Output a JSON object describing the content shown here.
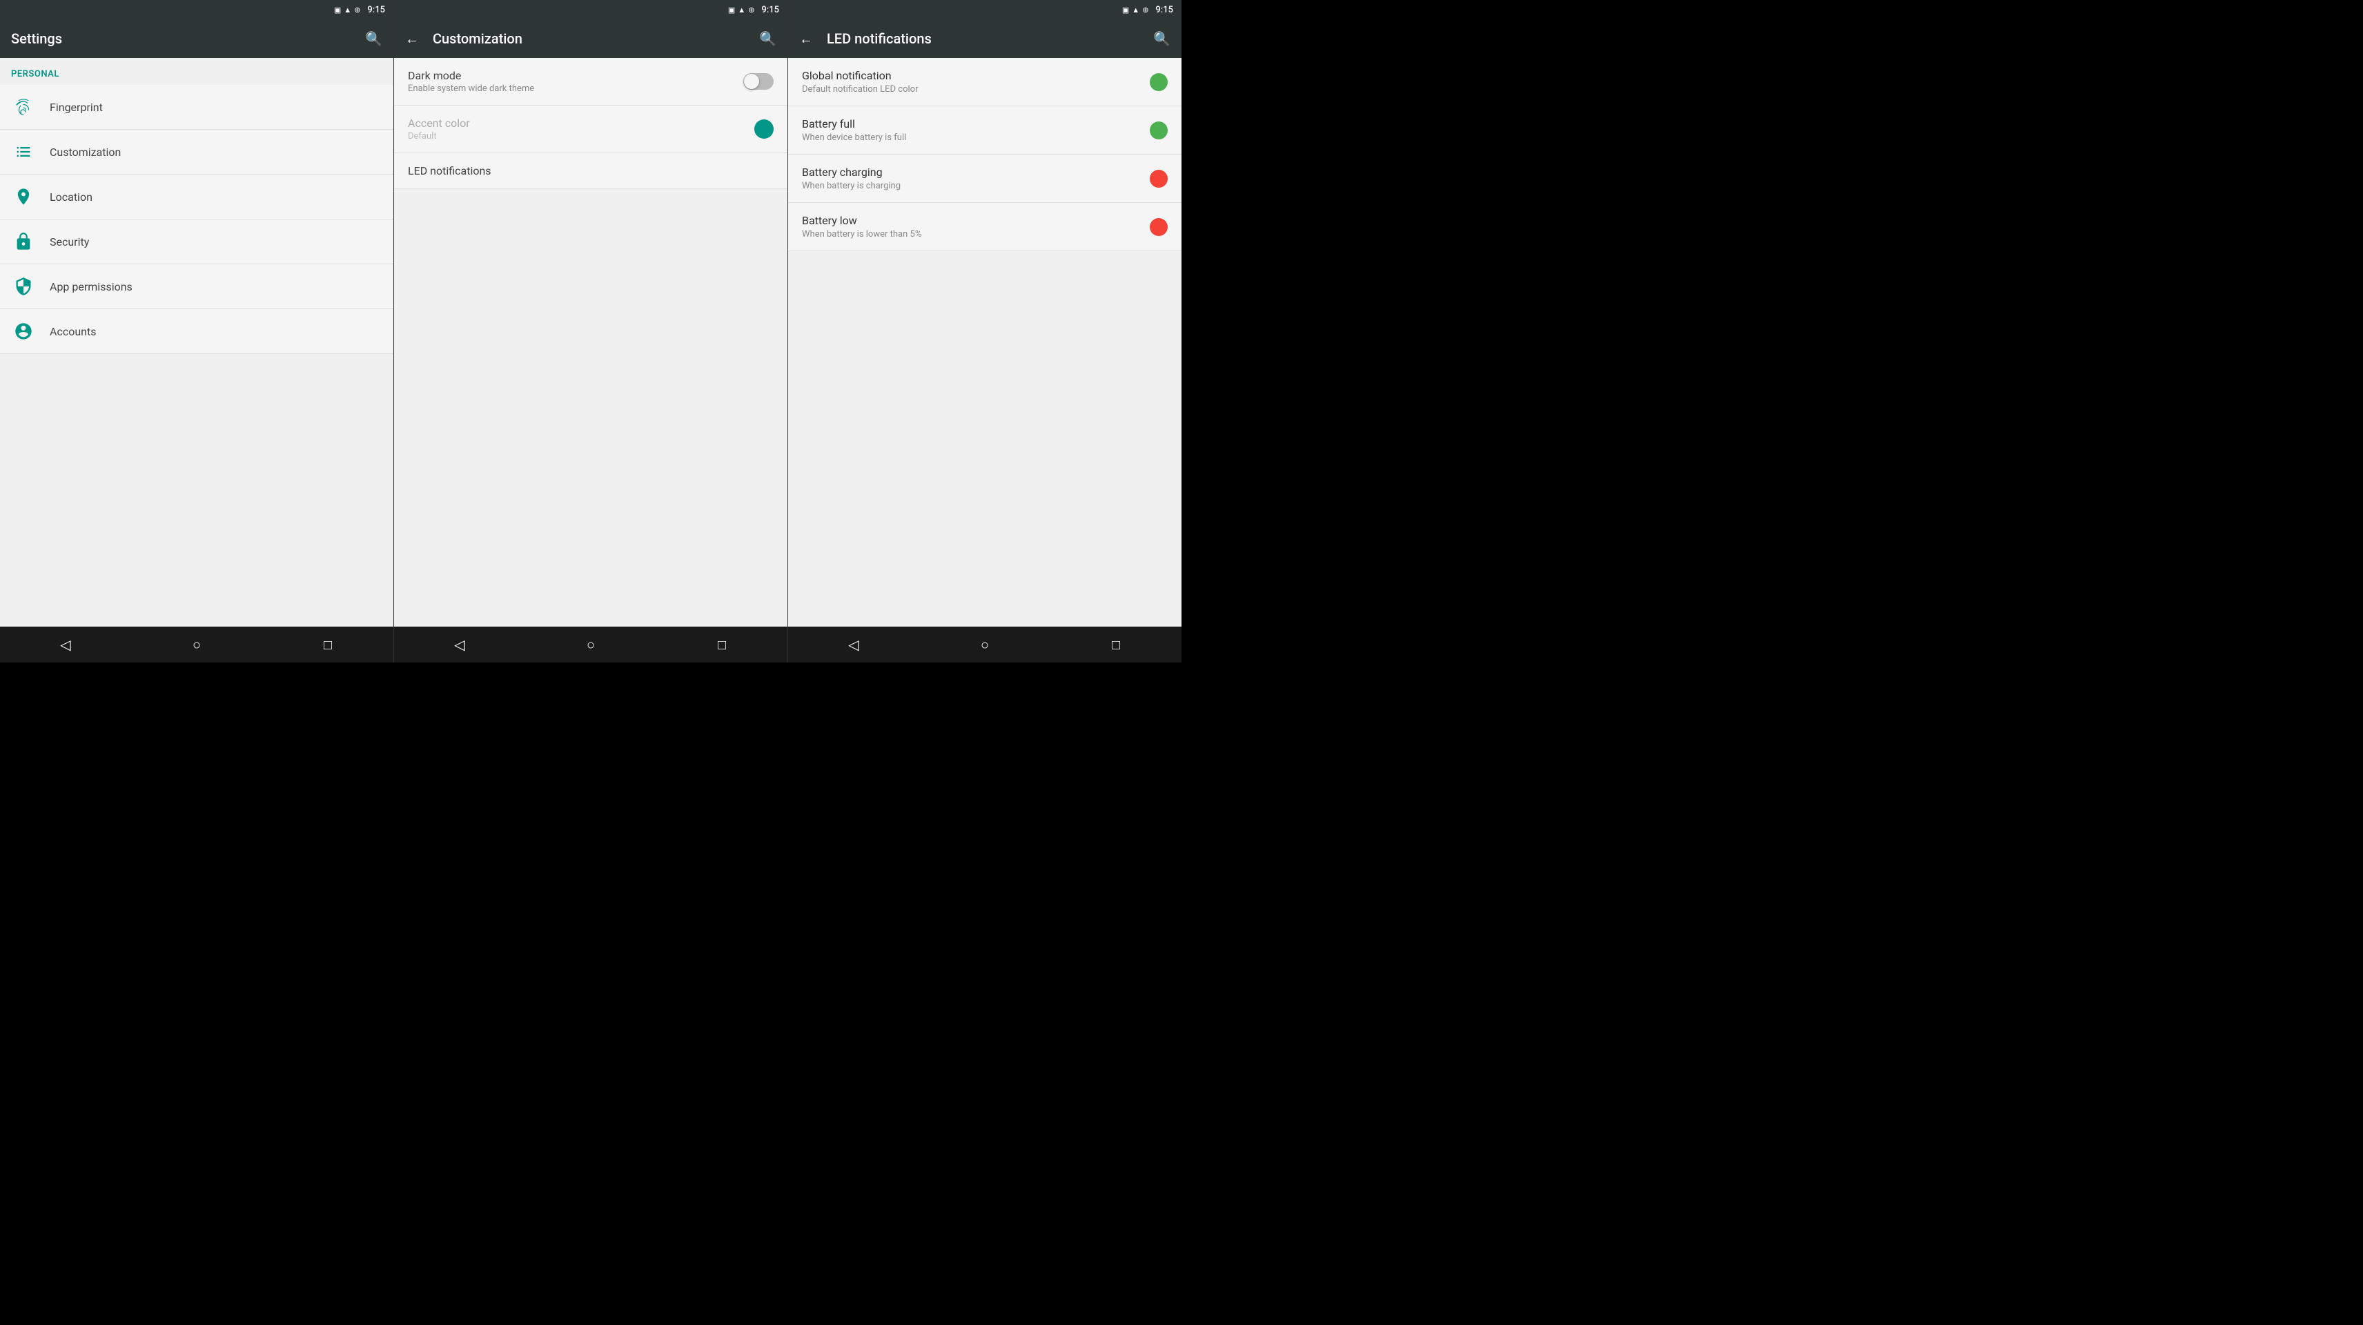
{
  "colors": {
    "teal": "#009688",
    "darkBar": "#2d3535",
    "green": "#4caf50",
    "red": "#f44336",
    "lightBg": "#f5f5f5"
  },
  "statusBar": {
    "time": "9:15"
  },
  "panel1": {
    "title": "Settings",
    "sectionLabel": "Personal",
    "items": [
      {
        "id": "fingerprint",
        "label": "Fingerprint"
      },
      {
        "id": "customization",
        "label": "Customization"
      },
      {
        "id": "location",
        "label": "Location"
      },
      {
        "id": "security",
        "label": "Security"
      },
      {
        "id": "app-permissions",
        "label": "App permissions"
      },
      {
        "id": "accounts",
        "label": "Accounts"
      }
    ],
    "nav": {
      "back": "◁",
      "home": "○",
      "recent": "□"
    }
  },
  "panel2": {
    "title": "Customization",
    "backBtn": "←",
    "rows": [
      {
        "id": "dark-mode",
        "title": "Dark mode",
        "subtitle": "Enable system wide dark theme",
        "hasToggle": true,
        "toggleOn": false,
        "hasDot": false,
        "dotColor": null,
        "dimmed": false
      },
      {
        "id": "accent-color",
        "title": "Accent color",
        "subtitle": "Default",
        "hasToggle": false,
        "hasDot": true,
        "dotColor": "#009688",
        "dimmed": true
      },
      {
        "id": "led-notifications",
        "title": "LED notifications",
        "subtitle": "",
        "hasToggle": false,
        "hasDot": false,
        "dotColor": null,
        "dimmed": false
      }
    ],
    "nav": {
      "back": "◁",
      "home": "○",
      "recent": "□"
    }
  },
  "panel3": {
    "title": "LED notifications",
    "backBtn": "←",
    "items": [
      {
        "id": "global-notification",
        "title": "Global notification",
        "subtitle": "Default notification LED color",
        "dotColor": "#4caf50"
      },
      {
        "id": "battery-full",
        "title": "Battery full",
        "subtitle": "When device battery is full",
        "dotColor": "#4caf50"
      },
      {
        "id": "battery-charging",
        "title": "Battery charging",
        "subtitle": "When battery is charging",
        "dotColor": "#f44336"
      },
      {
        "id": "battery-low",
        "title": "Battery low",
        "subtitle": "When battery is lower than 5%",
        "dotColor": "#f44336"
      }
    ],
    "nav": {
      "back": "◁",
      "home": "○",
      "recent": "□"
    }
  }
}
